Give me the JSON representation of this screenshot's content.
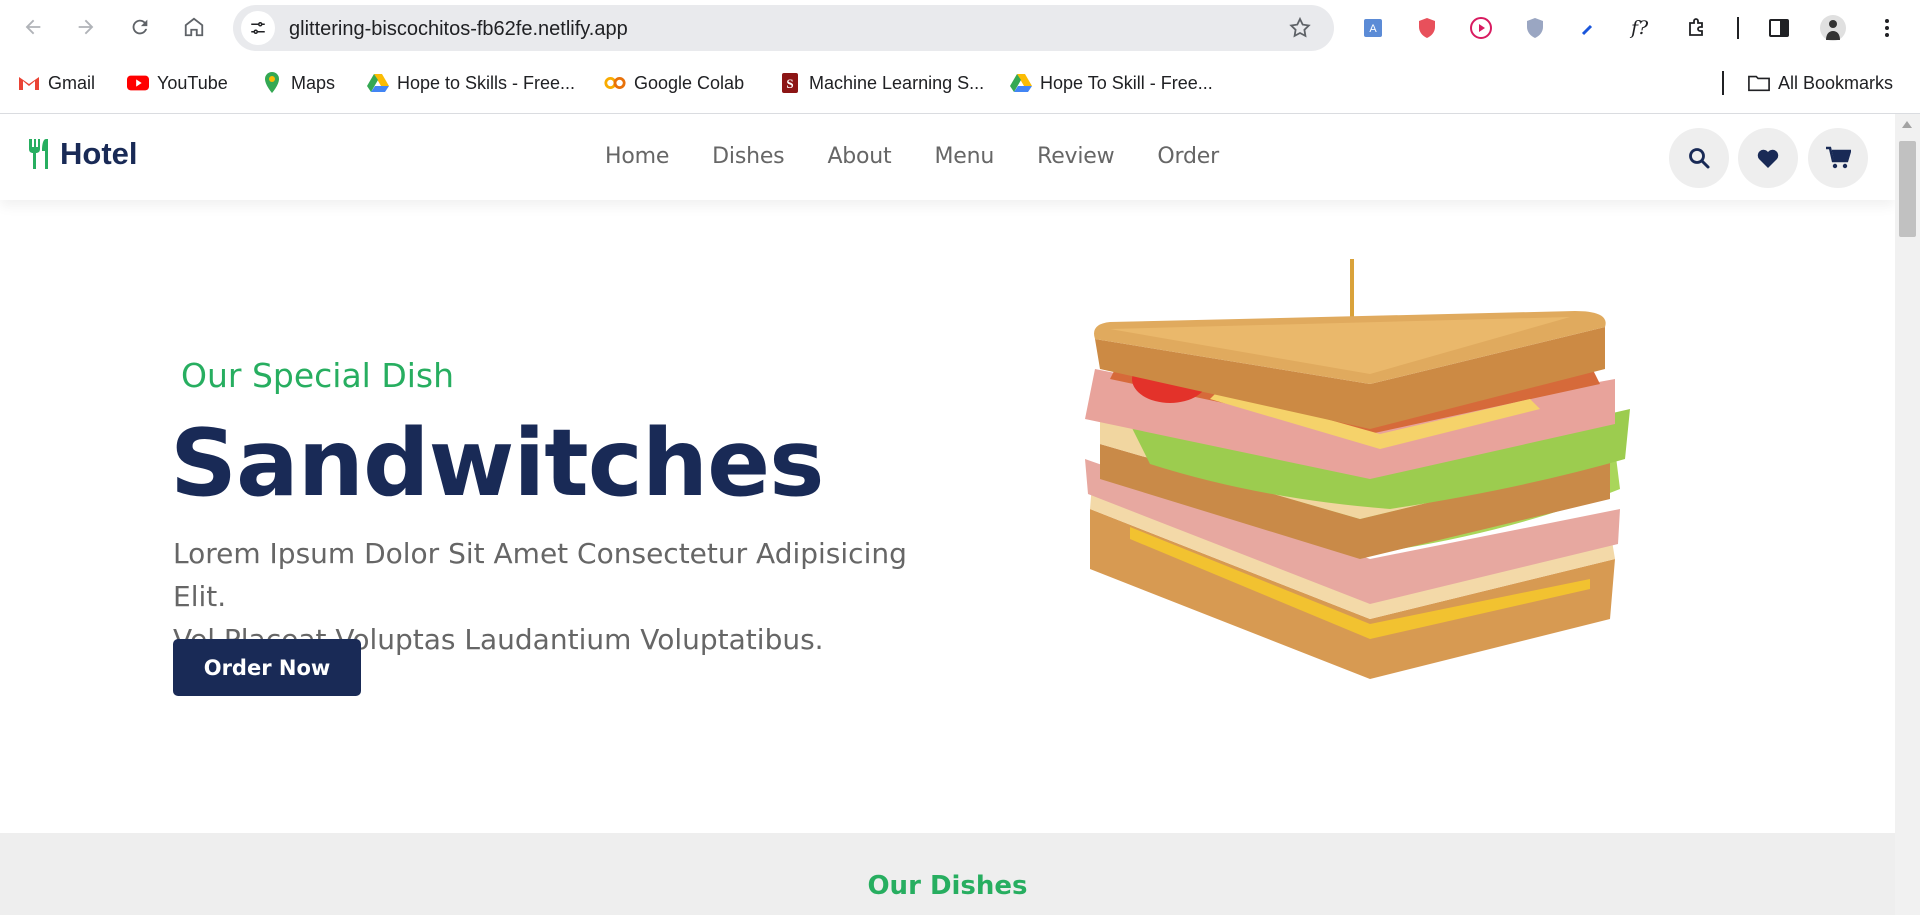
{
  "browser": {
    "url": "glittering-biscochitos-fb62fe.netlify.app",
    "bookmarks": [
      {
        "label": "Gmail",
        "icon": "gmail-icon"
      },
      {
        "label": "YouTube",
        "icon": "youtube-icon"
      },
      {
        "label": "Maps",
        "icon": "maps-icon"
      },
      {
        "label": "Hope to Skills - Free...",
        "icon": "google-drive-icon"
      },
      {
        "label": "Google Colab",
        "icon": "colab-icon"
      },
      {
        "label": "Machine Learning S...",
        "icon": "stanford-icon"
      },
      {
        "label": "Hope To Skill - Free...",
        "icon": "google-drive-icon"
      }
    ],
    "all_bookmarks": "All Bookmarks"
  },
  "header": {
    "logo_text": "Hotel",
    "nav": [
      "Home",
      "Dishes",
      "About",
      "Menu",
      "Review",
      "Order"
    ]
  },
  "hero": {
    "subtitle": "Our Special Dish",
    "title": "Sandwitches",
    "text_line1": "Lorem Ipsum Dolor Sit Amet Consectetur Adipisicing Elit.",
    "text_line2": "Vel Placeat Voluptas Laudantium Voluptatibus.",
    "button": "Order Now"
  },
  "dishes": {
    "subtitle": "Our Dishes"
  },
  "colors": {
    "primary": "#192a56",
    "accent": "#27ae60",
    "text": "#666666"
  }
}
